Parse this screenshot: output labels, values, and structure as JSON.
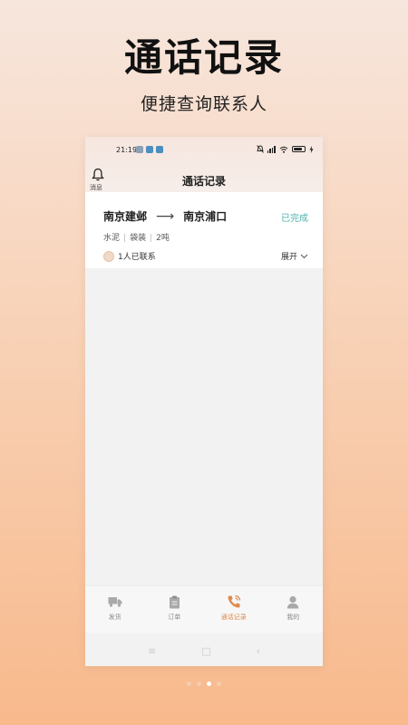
{
  "hero": {
    "title": "通话记录",
    "subtitle": "便捷查询联系人"
  },
  "status_bar": {
    "time": "21:19",
    "battery_level": 0.8
  },
  "header": {
    "bell_label": "消息",
    "title": "通话记录"
  },
  "record": {
    "origin": "南京建邺",
    "arrow": "⟶",
    "destination": "南京浦口",
    "status": "已完成",
    "cargo": [
      "水泥",
      "袋装",
      "2吨"
    ],
    "contacted": "1人已联系",
    "expand_label": "展开"
  },
  "tabs": [
    {
      "label": "发货",
      "icon": "truck-icon"
    },
    {
      "label": "订单",
      "icon": "clipboard-icon"
    },
    {
      "label": "通话记录",
      "icon": "phone-icon",
      "active": true
    },
    {
      "label": "我的",
      "icon": "person-icon"
    }
  ],
  "system_nav": {
    "menu": "≡",
    "home": "□",
    "back": "‹"
  },
  "colors": {
    "accent": "#e08a4e",
    "status_done": "#4fb3ae"
  },
  "pager": {
    "count": 4,
    "active_index": 2
  }
}
